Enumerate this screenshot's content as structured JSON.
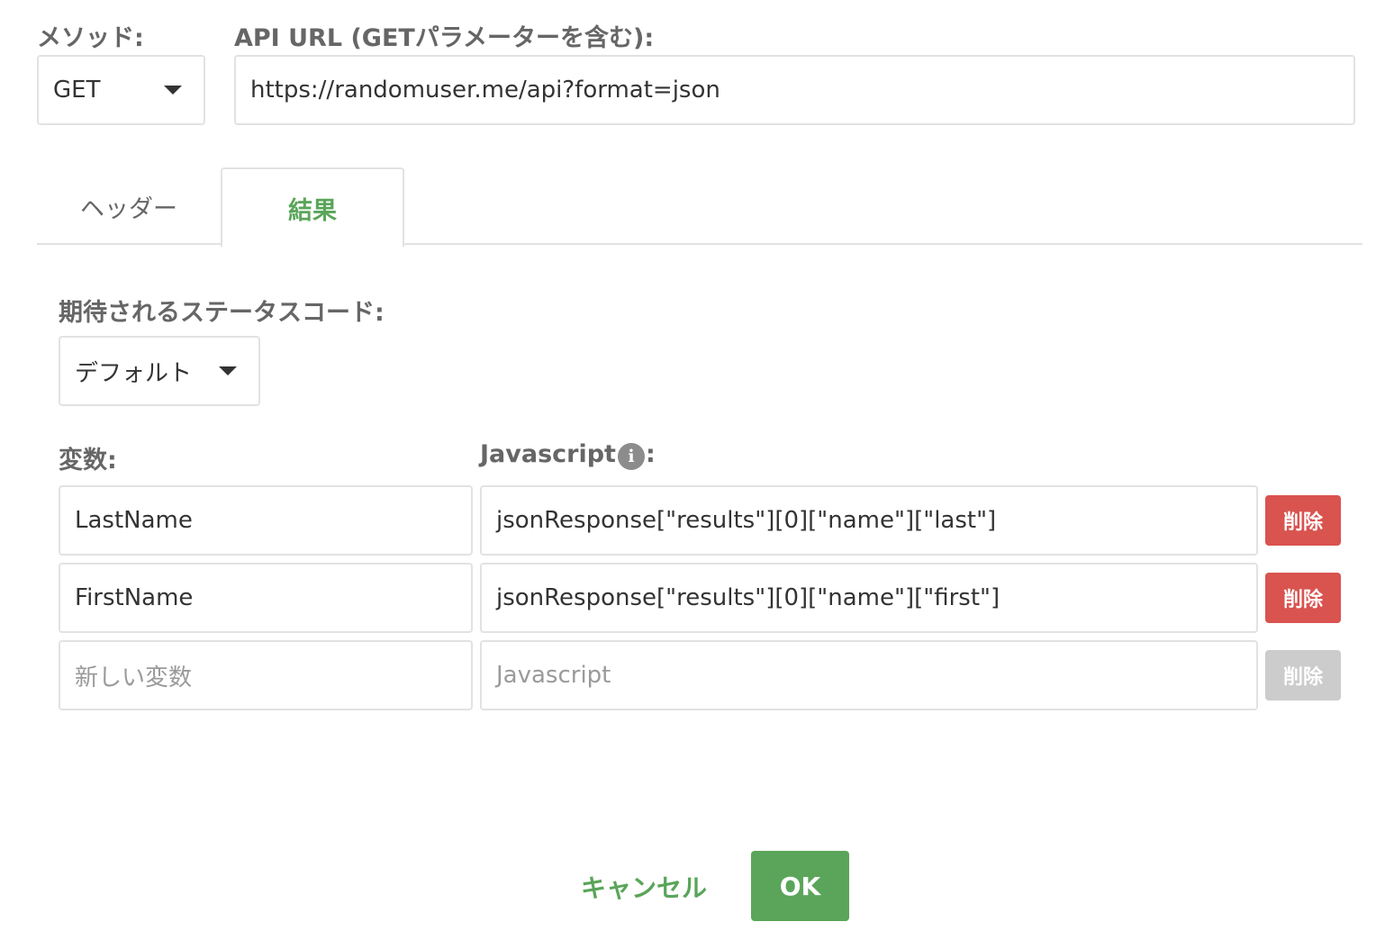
{
  "request": {
    "method_label": "メソッド:",
    "method_value": "GET",
    "url_label": "API URL (GETパラメーターを含む):",
    "url_value": "https://randomuser.me/api?format=json"
  },
  "tabs": [
    {
      "label": "ヘッダー",
      "active": false
    },
    {
      "label": "結果",
      "active": true
    }
  ],
  "result": {
    "status_label": "期待されるステータスコード:",
    "status_value": "デフォルト",
    "variable_header": "変数:",
    "javascript_header": "Javascript",
    "javascript_header_suffix": ":",
    "info_icon_glyph": "i",
    "rows": [
      {
        "variable": "LastName",
        "javascript": "jsonResponse[\"results\"][0][\"name\"][\"last\"]",
        "delete_label": "削除"
      },
      {
        "variable": "FirstName",
        "javascript": "jsonResponse[\"results\"][0][\"name\"][\"first\"]",
        "delete_label": "削除"
      }
    ],
    "new_row": {
      "variable_placeholder": "新しい変数",
      "javascript_placeholder": "Javascript",
      "delete_label": "削除"
    }
  },
  "footer": {
    "cancel_label": "キャンセル",
    "ok_label": "OK"
  },
  "colors": {
    "accent_green": "#5aa55a",
    "delete_red": "#d9534f",
    "disabled_gray": "#cccccc"
  }
}
